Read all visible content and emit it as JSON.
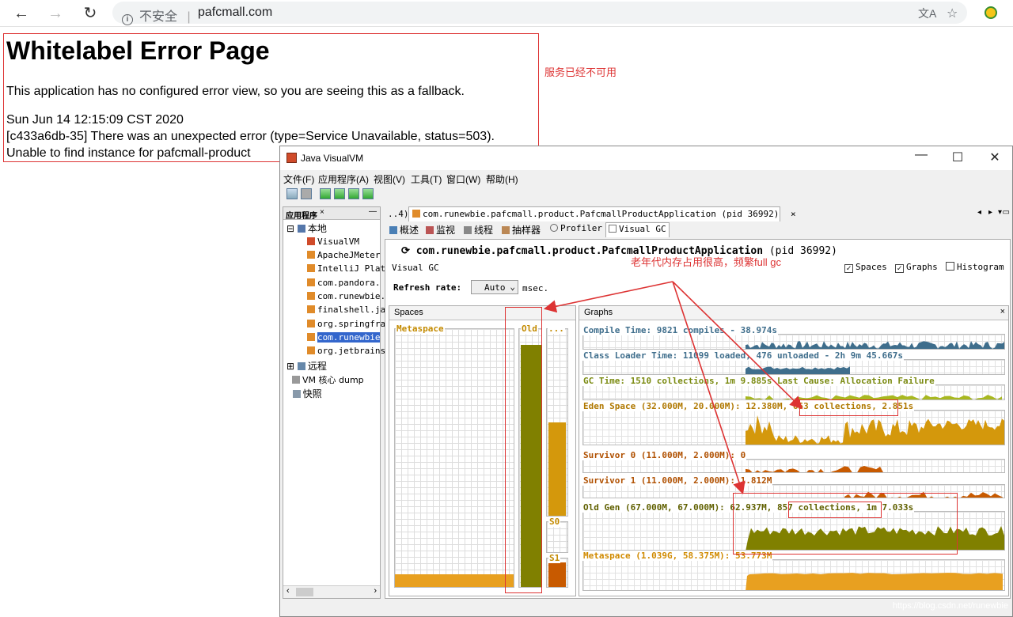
{
  "browser": {
    "back": "←",
    "forward": "→",
    "reload": "↻",
    "security": "不安全",
    "separator": "|",
    "url": "pafcmall.com",
    "translate_icon": "translate-icon",
    "star_icon": "star-icon",
    "extension_icon": "extension-icon"
  },
  "error_page": {
    "title": "Whitelabel Error Page",
    "line1": "This application has no configured error view, so you are seeing this as a fallback.",
    "line2": "Sun Jun 14 12:15:09 CST 2020",
    "line3": "[c433a6db-35] There was an unexpected error (type=Service Unavailable, status=503).",
    "line4": "Unable to find instance for pafcmall-product",
    "annotation": "服务已经不可用"
  },
  "visualvm": {
    "title": "Java VisualVM",
    "window_controls": {
      "minimize": "—",
      "maximize": "☐",
      "close": "✕"
    },
    "menus": [
      "文件(F)",
      "应用程序(A)",
      "视图(V)",
      "工具(T)",
      "窗口(W)",
      "帮助(H)"
    ],
    "left_panel": {
      "title": "应用程序",
      "close": "×",
      "minimize": "—",
      "local": "本地",
      "items": [
        "VisualVM",
        "ApacheJMeter",
        "IntelliJ Plat",
        "com.pandora.",
        "com.runewbie.",
        "finalshell.ja",
        "org.springfra",
        "com.runewbie",
        "org.jetbrains"
      ],
      "remote": "远程",
      "core_dump": "VM 核心 dump",
      "snapshots": "快照"
    },
    "doc_tab_overflow": "..4)",
    "doc_tab": "com.runewbie.pafcmall.product.PafcmallProductApplication (pid 36992)",
    "doc_tab_close": "×",
    "subtabs": [
      "概述",
      "监视",
      "线程",
      "抽样器",
      "Profiler",
      "Visual GC"
    ],
    "app_name": "com.runewbie.pafcmall.product.PafcmallProductApplication",
    "app_pid": "(pid 36992)",
    "section": "Visual GC",
    "checkboxes": [
      {
        "label": "Spaces",
        "checked": true
      },
      {
        "label": "Graphs",
        "checked": true
      },
      {
        "label": "Histogram",
        "checked": false
      }
    ],
    "refresh_label": "Refresh rate:",
    "refresh_value": "Auto",
    "refresh_unit": "msec.",
    "annotation": "老年代内存占用很高，频繁full gc",
    "spaces": {
      "title": "Spaces",
      "metaspace": "Metaspace",
      "old": "Old",
      "dots": "...",
      "s0": "S0",
      "s1": "S1",
      "old_fill": 0.94,
      "metaspace_fill": 0.05,
      "eden_fill": 0.5,
      "s1_fill": 0.85
    },
    "graphs": {
      "title": "Graphs",
      "compile": "Compile Time: 9821 compiles - 38.974s",
      "classloader": "Class Loader Time: 11099 loaded, 476 unloaded - 2h 9m 45.667s",
      "gc": "GC Time: 1510 collections, 1m 9.885s  Last Cause: Allocation Failure",
      "eden": "Eden Space (32.000M, 20.000M): 12.380M, 653 collections, 2.851s",
      "survivor0": "Survivor 0 (11.000M, 2.000M): 0",
      "survivor1": "Survivor 1 (11.000M, 2.000M): 1.812M",
      "oldgen": "Old Gen (67.000M, 67.000M): 62.937M, 857 collections, 1m 7.033s",
      "metaspace": "Metaspace (1.039G, 58.375M): 53.773M"
    },
    "colors": {
      "old": "#808000",
      "eden": "#d4980c",
      "survivor": "#c85a00",
      "metaspace": "#e8a020",
      "compile": "#3f6e8c",
      "gc": "#a8b820",
      "annotation": "#dd3333"
    }
  },
  "watermark": "https://blog.csdn.net/runewbie"
}
